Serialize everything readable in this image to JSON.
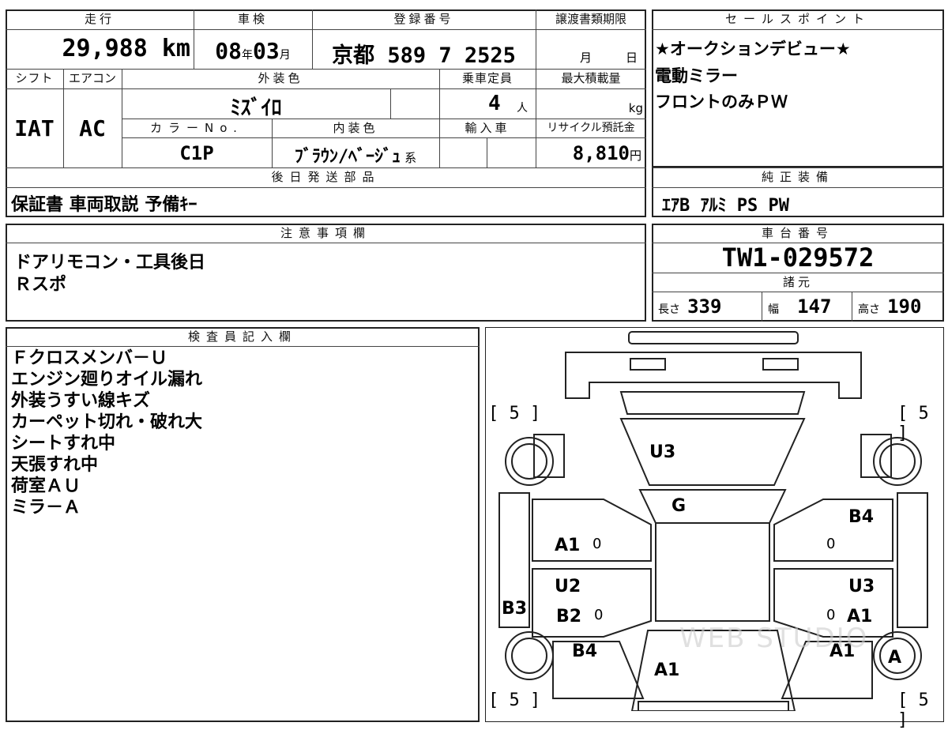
{
  "mileage": {
    "label": "走行",
    "value": "29,988",
    "unit": "km"
  },
  "inspection": {
    "label": "車検",
    "year": "08",
    "year_unit": "年",
    "month": "03",
    "month_unit": "月"
  },
  "registration": {
    "label": "登録番号",
    "region": "京都",
    "number": "589 7 2525"
  },
  "transfer": {
    "label": "譲渡書類期限",
    "month_unit": "月",
    "day_unit": "日"
  },
  "sales_point": {
    "label": "セールスポイント",
    "lines": [
      "★オークションデビュー★",
      "電動ミラー",
      "フロントのみＰＷ"
    ]
  },
  "shift": {
    "label": "シフト",
    "value": "IAT"
  },
  "aircon": {
    "label": "エアコン",
    "value": "AC"
  },
  "exterior_color": {
    "label": "外装色",
    "value": "ﾐｽﾞｲﾛ"
  },
  "capacity": {
    "label": "乗車定員",
    "value": "4",
    "unit": "人"
  },
  "max_load": {
    "label": "最大積載量",
    "unit": "kg"
  },
  "color_no": {
    "label": "カラーNo.",
    "value": "C1P"
  },
  "interior_color": {
    "label": "内装色",
    "value": "ﾌﾞﾗｳﾝ/ﾍﾞｰｼﾞｭ",
    "suffix": "系"
  },
  "import": {
    "label": "輸入車"
  },
  "recycle": {
    "label": "リサイクル預託金",
    "value": "8,810",
    "unit": "円"
  },
  "later_parts": {
    "label": "後日発送部品",
    "value": "保証書 車両取説 予備ｷｰ"
  },
  "genuine_equipment": {
    "label": "純正装備",
    "value": "ｴｱB ｱﾙﾐ PS PW"
  },
  "notes": {
    "label": "注意事項欄",
    "lines": [
      "ドアリモコン・工具後日",
      "Ｒスポ"
    ]
  },
  "chassis": {
    "label": "車台番号",
    "value": "TW1-029572"
  },
  "specs": {
    "label": "諸元",
    "length_label": "長さ",
    "length": "339",
    "width_label": "幅",
    "width": "147",
    "height_label": "高さ",
    "height": "190"
  },
  "inspector": {
    "label": "検査員記入欄",
    "lines": [
      "Ｆクロスメンバ－Ｕ",
      "エンジン廻りオイル漏れ",
      "外装うすい線キズ",
      "カーペット切れ・破れ大",
      "シートすれ中",
      "天張すれ中",
      "荷室ＡＵ",
      "ミラ－Ａ"
    ]
  },
  "diagram": {
    "tread_fl": "[ 5 ]",
    "tread_fr": "[ 5 ]",
    "tread_rl": "[ 5 ]",
    "tread_rr": "[ 5 ]",
    "marks": {
      "roof": "U3",
      "hood": "G",
      "lf_door": "A1",
      "lf_door2": "U2",
      "lf_rear": "B2",
      "lf_fender": "B4",
      "left_side": "B3",
      "rf_door": "B4",
      "rf_rear": "U3",
      "rf_rear2": "A1",
      "rf_fender": "A1",
      "front": "A1",
      "wheel_rf": "A",
      "zero1": "0",
      "zero2": "0",
      "zero3": "0",
      "zero4": "0"
    },
    "watermark": "WEB STUDIO"
  }
}
